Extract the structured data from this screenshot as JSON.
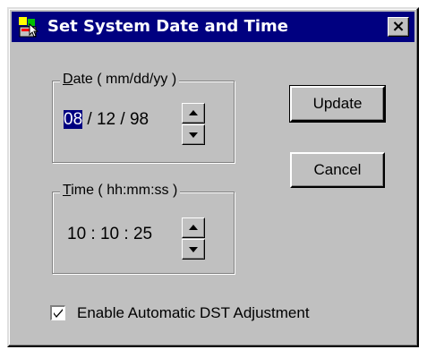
{
  "dialog": {
    "title": "Set System Date and Time",
    "close_glyph": "×",
    "title_icon": "datetime-app-icon"
  },
  "date_group": {
    "label_accel": "D",
    "label_rest": "ate ( mm/dd/yy )",
    "month": "08",
    "rest": " / 12 / 98"
  },
  "time_group": {
    "label_accel": "T",
    "label_rest": "ime ( hh:mm:ss )",
    "value": "10 : 10 :  25"
  },
  "buttons": {
    "update": "Update",
    "cancel": "Cancel"
  },
  "dst": {
    "label": "Enable Automatic DST Adjustment",
    "checked": true
  },
  "colors": {
    "titlebar": "#000080",
    "face": "#c0c0c0",
    "selection": "#000080"
  }
}
